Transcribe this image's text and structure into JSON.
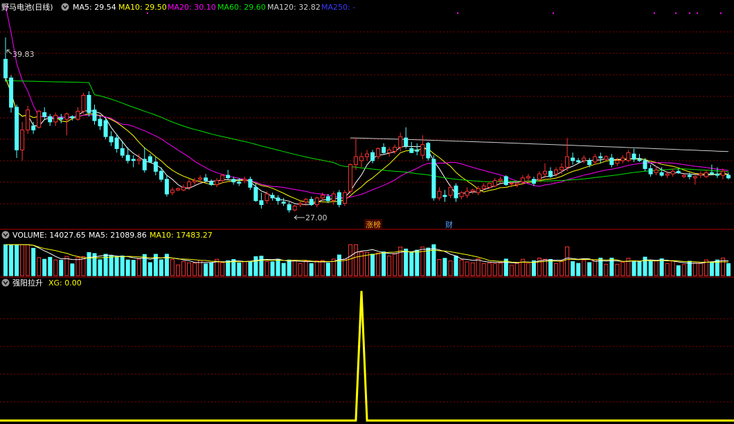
{
  "colors": {
    "up": "#ff3232",
    "down": "#54ffff",
    "ma5": "#ffffff",
    "ma10": "#ffff00",
    "ma20": "#ff00ff",
    "ma60": "#00e600",
    "ma120": "#cfcfcf",
    "ma250": "#3a3aff",
    "grid": "#8a0000",
    "signal": "#ffff00"
  },
  "main_header": {
    "title": "野马电池(日线)",
    "ma5": "MA5: 29.54",
    "ma10": "MA10: 29.50",
    "ma20": "MA20: 30.10",
    "ma60": "MA60: 29.60",
    "ma120": "MA120: 32.82",
    "ma250": "MA250: -"
  },
  "main_annotations": {
    "high": "39.83",
    "low": "27.00",
    "tag1": "涨榜",
    "tag2": "财"
  },
  "volume_header": {
    "name": "VOLUME: 14027.65",
    "ma5": "MA5: 21089.86",
    "ma10": "MA10: 17483.27"
  },
  "indicator_header": {
    "name": "强阳拉升",
    "value": "XG: 0.00"
  },
  "chart_data": [
    {
      "type": "candlestick",
      "title": "野马电池(日线)",
      "ylim": [
        25.5,
        41.5
      ],
      "ohlc": [
        [
          38.2,
          39.83,
          36.5,
          36.8
        ],
        [
          36.8,
          37.0,
          34.2,
          34.6
        ],
        [
          34.6,
          34.8,
          30.8,
          31.4
        ],
        [
          31.4,
          33.5,
          30.6,
          32.9
        ],
        [
          32.9,
          34.7,
          32.6,
          34.4
        ],
        [
          33.2,
          33.5,
          32.6,
          32.9
        ],
        [
          33.1,
          34.4,
          33.0,
          34.3
        ],
        [
          34.2,
          34.6,
          33.7,
          33.9
        ],
        [
          33.9,
          34.1,
          33.2,
          33.5
        ],
        [
          33.5,
          34.2,
          33.2,
          34.0
        ],
        [
          33.8,
          34.1,
          33.4,
          33.7
        ],
        [
          33.7,
          34.2,
          32.5,
          34.1
        ],
        [
          33.9,
          34.0,
          33.6,
          33.8
        ],
        [
          33.7,
          34.6,
          33.6,
          34.3
        ],
        [
          34.3,
          35.7,
          34.1,
          35.5
        ],
        [
          35.5,
          35.8,
          33.9,
          34.2
        ],
        [
          34.4,
          34.8,
          33.3,
          33.6
        ],
        [
          33.7,
          34.0,
          32.9,
          33.2
        ],
        [
          33.6,
          33.8,
          32.2,
          32.4
        ],
        [
          32.4,
          32.8,
          31.7,
          32.0
        ],
        [
          32.3,
          32.6,
          31.2,
          31.5
        ],
        [
          31.5,
          32.1,
          30.8,
          31.0
        ],
        [
          31.0,
          31.6,
          30.4,
          30.6
        ],
        [
          30.7,
          31.0,
          30.1,
          30.6
        ],
        [
          30.6,
          31.1,
          30.3,
          30.7
        ],
        [
          30.7,
          31.6,
          29.7,
          29.9
        ],
        [
          30.9,
          31.1,
          30.6,
          30.5
        ],
        [
          30.5,
          30.9,
          29.5,
          29.8
        ],
        [
          29.8,
          30.1,
          29.0,
          29.2
        ],
        [
          29.2,
          29.5,
          27.9,
          28.1
        ],
        [
          28.2,
          28.6,
          28.0,
          28.4
        ],
        [
          28.4,
          28.6,
          28.3,
          28.5
        ],
        [
          28.4,
          28.8,
          28.3,
          28.6
        ],
        [
          28.6,
          29.2,
          28.4,
          29.0
        ],
        [
          29.0,
          29.3,
          28.8,
          29.1
        ],
        [
          29.2,
          29.5,
          28.9,
          29.3
        ],
        [
          29.3,
          29.6,
          29.0,
          29.1
        ],
        [
          29.0,
          29.2,
          28.7,
          28.8
        ],
        [
          28.8,
          29.3,
          28.6,
          29.1
        ],
        [
          29.1,
          29.6,
          28.9,
          29.5
        ],
        [
          29.5,
          29.9,
          29.2,
          29.3
        ],
        [
          29.2,
          29.4,
          28.8,
          29.0
        ],
        [
          29.0,
          29.3,
          28.7,
          28.9
        ],
        [
          29.1,
          29.4,
          28.9,
          29.2
        ],
        [
          29.2,
          29.4,
          28.4,
          28.6
        ],
        [
          28.6,
          28.9,
          27.5,
          27.6
        ],
        [
          27.6,
          28.2,
          27.0,
          27.3
        ],
        [
          27.6,
          28.3,
          27.4,
          28.1
        ],
        [
          28.0,
          28.2,
          27.6,
          27.8
        ],
        [
          27.8,
          28.0,
          27.3,
          27.6
        ],
        [
          27.5,
          27.8,
          27.2,
          27.4
        ],
        [
          27.3,
          27.5,
          26.7,
          26.9
        ],
        [
          26.9,
          27.3,
          26.8,
          27.2
        ],
        [
          27.3,
          27.6,
          27.1,
          27.4
        ],
        [
          27.5,
          27.8,
          27.2,
          27.7
        ],
        [
          27.7,
          27.9,
          27.2,
          27.3
        ],
        [
          27.3,
          27.9,
          27.1,
          27.8
        ],
        [
          27.8,
          28.2,
          27.6,
          28.0
        ],
        [
          27.9,
          28.1,
          27.4,
          27.6
        ],
        [
          27.6,
          28.3,
          27.3,
          28.1
        ],
        [
          28.2,
          28.4,
          27.1,
          27.3
        ],
        [
          27.4,
          28.4,
          27.2,
          28.2
        ],
        [
          28.3,
          30.4,
          28.1,
          30.3
        ],
        [
          30.3,
          32.3,
          29.9,
          30.9
        ],
        [
          30.6,
          31.2,
          30.1,
          30.9
        ],
        [
          30.9,
          31.4,
          30.6,
          31.1
        ],
        [
          31.2,
          31.4,
          30.4,
          30.6
        ],
        [
          30.9,
          31.6,
          30.7,
          31.5
        ],
        [
          31.6,
          31.9,
          31.1,
          31.2
        ],
        [
          31.2,
          31.6,
          30.9,
          31.4
        ],
        [
          31.3,
          31.8,
          31.1,
          31.6
        ],
        [
          31.6,
          32.7,
          31.3,
          32.4
        ],
        [
          32.3,
          33.1,
          31.5,
          31.7
        ],
        [
          31.5,
          32.0,
          31.2,
          31.2
        ],
        [
          31.4,
          31.9,
          31.0,
          31.3
        ],
        [
          31.0,
          32.5,
          30.7,
          31.8
        ],
        [
          31.9,
          32.0,
          30.6,
          30.8
        ],
        [
          30.7,
          31.0,
          27.6,
          27.8
        ],
        [
          27.8,
          28.6,
          27.6,
          28.3
        ],
        [
          28.0,
          28.4,
          27.5,
          27.9
        ],
        [
          28.0,
          28.8,
          27.8,
          28.6
        ],
        [
          28.7,
          28.9,
          27.5,
          27.8
        ],
        [
          27.9,
          28.3,
          27.7,
          28.2
        ],
        [
          28.0,
          28.6,
          27.8,
          28.3
        ],
        [
          28.3,
          28.5,
          28.1,
          28.4
        ],
        [
          28.2,
          28.7,
          28.0,
          28.5
        ],
        [
          28.5,
          28.9,
          28.4,
          28.7
        ],
        [
          28.6,
          28.8,
          28.5,
          28.9
        ],
        [
          28.7,
          29.3,
          28.6,
          29.1
        ],
        [
          29.1,
          29.4,
          28.9,
          29.2
        ],
        [
          29.4,
          29.5,
          28.7,
          28.8
        ],
        [
          28.9,
          29.0,
          28.6,
          28.9
        ],
        [
          28.8,
          29.0,
          28.6,
          28.9
        ],
        [
          29.0,
          29.5,
          28.8,
          29.3
        ],
        [
          29.3,
          29.6,
          29.0,
          29.4
        ],
        [
          29.2,
          29.4,
          28.7,
          28.9
        ],
        [
          29.2,
          29.8,
          29.0,
          29.6
        ],
        [
          29.6,
          30.4,
          29.3,
          29.8
        ],
        [
          29.8,
          30.1,
          29.3,
          29.4
        ],
        [
          29.6,
          30.1,
          29.4,
          29.9
        ],
        [
          29.9,
          30.4,
          29.6,
          30.1
        ],
        [
          30.1,
          32.3,
          29.8,
          30.9
        ],
        [
          30.8,
          31.2,
          30.3,
          30.6
        ],
        [
          30.6,
          30.8,
          30.4,
          30.5
        ],
        [
          30.6,
          31.0,
          30.4,
          30.8
        ],
        [
          30.6,
          30.8,
          30.1,
          30.3
        ],
        [
          30.5,
          31.1,
          30.3,
          30.9
        ],
        [
          30.9,
          31.2,
          30.4,
          30.8
        ],
        [
          30.7,
          31.0,
          30.6,
          30.9
        ],
        [
          30.8,
          31.1,
          30.1,
          30.3
        ],
        [
          30.4,
          30.8,
          30.2,
          30.6
        ],
        [
          30.6,
          31.0,
          30.4,
          30.8
        ],
        [
          30.6,
          31.4,
          30.5,
          31.2
        ],
        [
          31.1,
          31.5,
          30.5,
          30.7
        ],
        [
          30.7,
          31.1,
          30.5,
          30.6
        ],
        [
          30.6,
          30.8,
          29.8,
          30.0
        ],
        [
          30.0,
          30.3,
          29.4,
          29.6
        ],
        [
          29.7,
          30.2,
          29.5,
          29.9
        ],
        [
          29.7,
          30.1,
          29.4,
          29.5
        ],
        [
          29.5,
          29.8,
          29.3,
          29.6
        ],
        [
          29.6,
          30.0,
          29.4,
          29.8
        ],
        [
          29.8,
          30.0,
          29.6,
          29.7
        ],
        [
          29.4,
          29.6,
          29.3,
          29.5
        ],
        [
          29.5,
          29.7,
          29.2,
          29.4
        ],
        [
          29.3,
          29.5,
          28.8,
          29.4
        ],
        [
          29.5,
          29.8,
          29.3,
          29.6
        ],
        [
          29.4,
          29.9,
          29.3,
          29.7
        ],
        [
          29.7,
          30.3,
          29.5,
          29.6
        ],
        [
          29.6,
          30.1,
          29.3,
          29.5
        ],
        [
          29.5,
          30.0,
          29.2,
          29.8
        ],
        [
          29.5,
          29.7,
          29.2,
          29.3
        ]
      ],
      "series": [
        {
          "name": "MA5",
          "values": []
        },
        {
          "name": "MA10",
          "values": []
        },
        {
          "name": "MA20",
          "values": []
        },
        {
          "name": "MA60",
          "values": []
        },
        {
          "name": "MA120",
          "values": [
            [
              62,
              32.3
            ],
            [
              140,
              31.1
            ]
          ]
        }
      ]
    },
    {
      "type": "bar",
      "title": "VOLUME",
      "ylim": [
        0,
        40000
      ],
      "values": []
    },
    {
      "type": "line",
      "title": "强阳拉升",
      "ylim": [
        0,
        1
      ],
      "spike_index": 64,
      "values": []
    }
  ]
}
